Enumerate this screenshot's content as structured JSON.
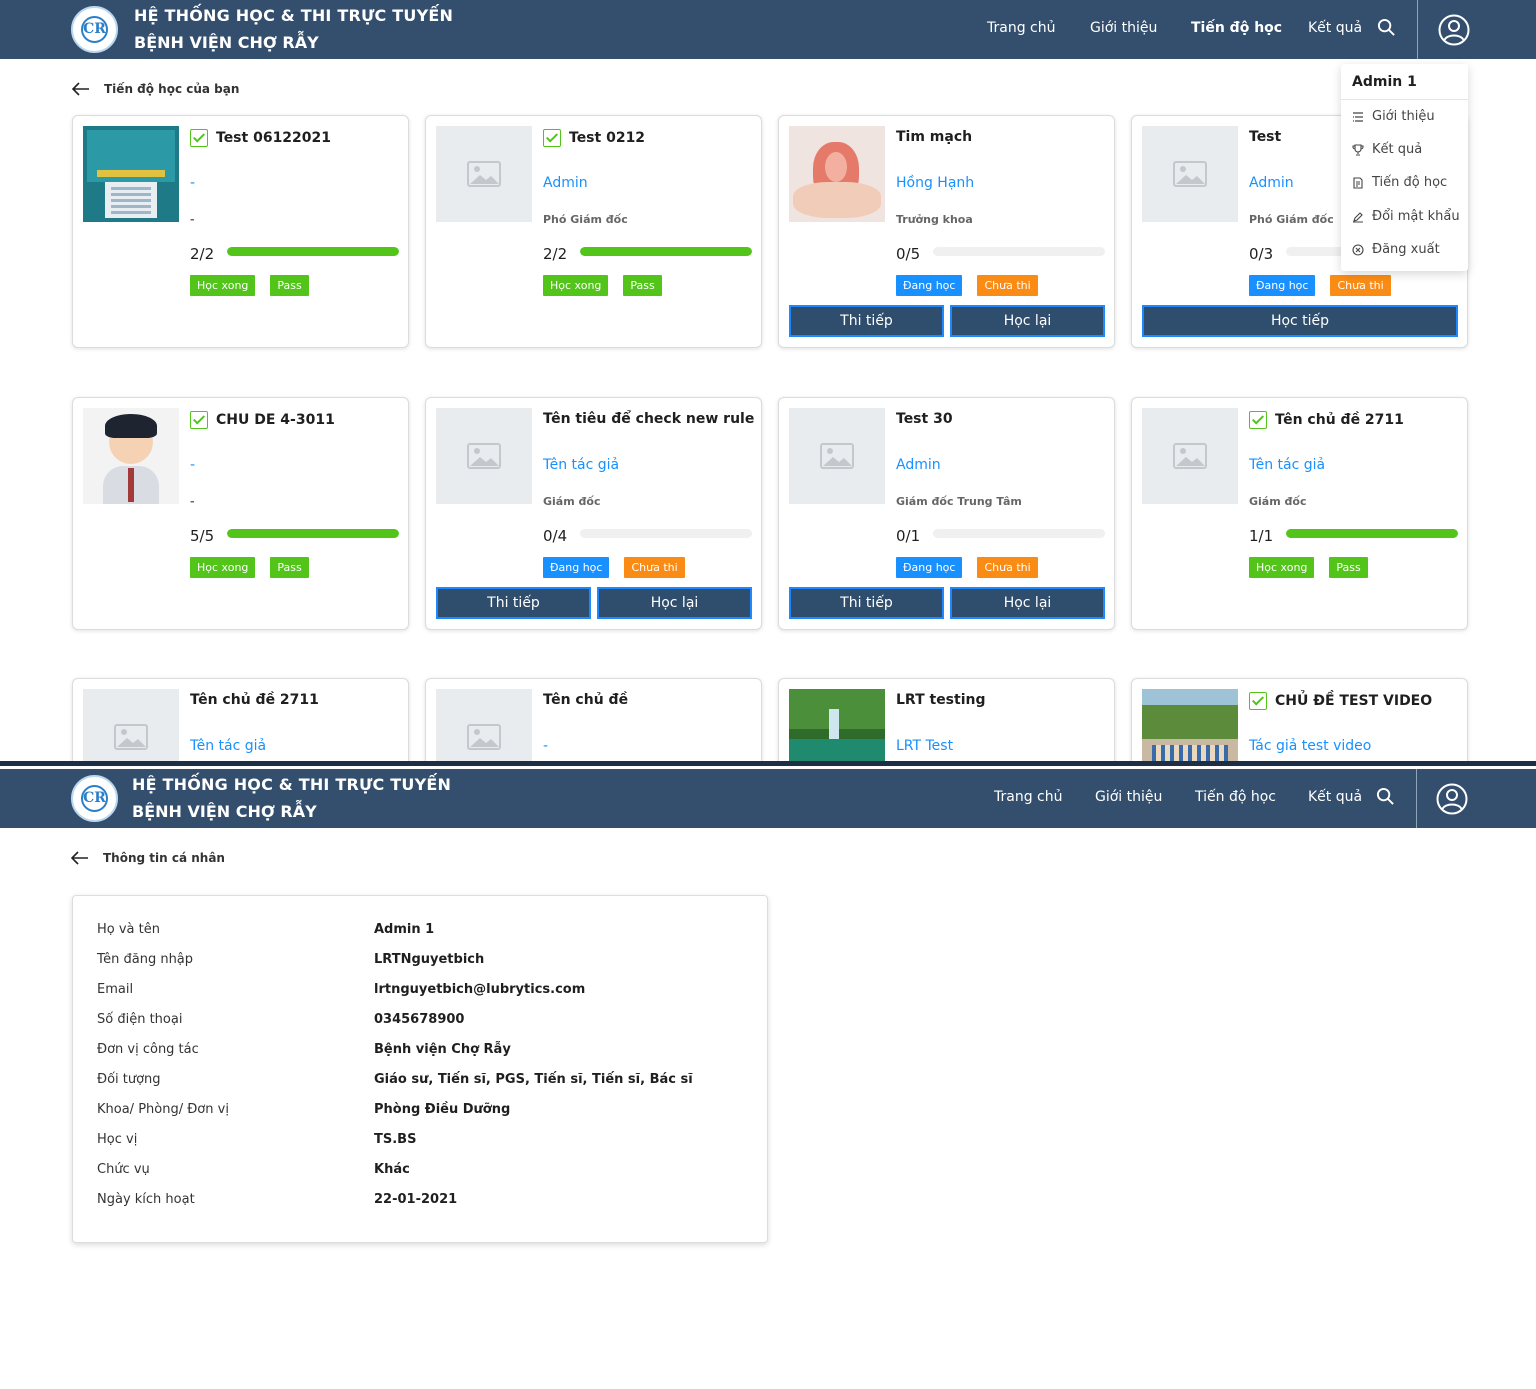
{
  "header": {
    "title_line1": "HỆ THỐNG HỌC & THI TRỰC TUYẾN",
    "title_line2": "BỆNH VIỆN CHỢ RẪY",
    "nav": [
      "Trang chủ",
      "Giới thiệu",
      "Tiến độ học",
      "Kết quả"
    ]
  },
  "progress_page": {
    "subtitle": "Tiến độ học của bạn",
    "cards": [
      {
        "title": "Test 06122021",
        "author": "-",
        "position": "-",
        "progress": "2/2",
        "progress_fraction": 1.0,
        "tags": [
          "Học xong",
          "Pass"
        ],
        "buttons": [],
        "checked": true
      },
      {
        "title": "Test 0212",
        "author": "Admin",
        "position": "Phó Giám đốc",
        "progress": "2/2",
        "progress_fraction": 1.0,
        "tags": [
          "Học xong",
          "Pass"
        ],
        "buttons": [],
        "checked": true
      },
      {
        "title": "Tim mạch",
        "author": "Hồng Hạnh",
        "position": "Trưởng khoa",
        "progress": "0/5",
        "progress_fraction": 0,
        "tags": [
          "Đang học",
          "Chưa thi"
        ],
        "buttons": [
          "Thi tiếp",
          "Học lại"
        ],
        "checked": false
      },
      {
        "title": "Test",
        "author": "Admin",
        "position": "Phó Giám đốc",
        "progress": "0/3",
        "progress_fraction": 0,
        "tags": [
          "Đang học",
          "Chưa thi"
        ],
        "buttons": [
          "Học tiếp"
        ],
        "checked": false
      },
      {
        "title": "CHU DE 4-3011",
        "author": "-",
        "position": "-",
        "progress": "5/5",
        "progress_fraction": 1.0,
        "tags": [
          "Học xong",
          "Pass"
        ],
        "buttons": [],
        "checked": true
      },
      {
        "title": "Tên tiêu để check new rule",
        "author": "Tên tác giả",
        "position": "Giám đốc",
        "progress": "0/4",
        "progress_fraction": 0,
        "tags": [
          "Đang học",
          "Chưa thi"
        ],
        "buttons": [
          "Thi tiếp",
          "Học lại"
        ],
        "checked": false
      },
      {
        "title": "Test 30",
        "author": "Admin",
        "position": "Giám đốc Trung Tâm",
        "progress": "0/1",
        "progress_fraction": 0,
        "tags": [
          "Đang học",
          "Chưa thi"
        ],
        "buttons": [
          "Thi tiếp",
          "Học lại"
        ],
        "checked": false
      },
      {
        "title": "Tên chủ đề 2711",
        "author": "Tên tác giả",
        "position": "Giám đốc",
        "progress": "1/1",
        "progress_fraction": 1.0,
        "tags": [
          "Học xong",
          "Pass"
        ],
        "buttons": [],
        "checked": true
      },
      {
        "title": "Tên chủ đề 2711",
        "author": "Tên tác giả",
        "checked": false
      },
      {
        "title": "Tên chủ đề",
        "author": "-",
        "checked": false
      },
      {
        "title": "LRT testing",
        "author": "LRT Test",
        "checked": false
      },
      {
        "title": "CHỦ ĐỀ TEST VIDEO",
        "author": "Tác giả test video",
        "checked": true
      }
    ]
  },
  "user_menu": {
    "name": "Admin 1",
    "items": [
      "Giới thiệu",
      "Kết quả",
      "Tiến độ học",
      "Đổi mật khẩu",
      "Đăng xuất"
    ]
  },
  "profile_page": {
    "subtitle": "Thông tin cá nhân",
    "fields": [
      {
        "label": "Họ và tên",
        "value": "Admin 1"
      },
      {
        "label": "Tên đăng nhập",
        "value": "LRTNguyetbich"
      },
      {
        "label": "Email",
        "value": "lrtnguyetbich@lubrytics.com"
      },
      {
        "label": "Số điện thoại",
        "value": "0345678900"
      },
      {
        "label": "Đơn vị công tác",
        "value": "Bệnh viện Chợ Rẫy"
      },
      {
        "label": "Đối tượng",
        "value": "Giáo sư, Tiến sĩ, PGS, Tiến sĩ, Tiến sĩ, Bác sĩ"
      },
      {
        "label": "Khoa/ Phòng/ Đơn vị",
        "value": "Phòng Điều Dưỡng"
      },
      {
        "label": "Học vị",
        "value": "TS.BS"
      },
      {
        "label": "Chức vụ",
        "value": "Khác"
      },
      {
        "label": "Ngày kích hoạt",
        "value": "22-01-2021"
      }
    ]
  }
}
